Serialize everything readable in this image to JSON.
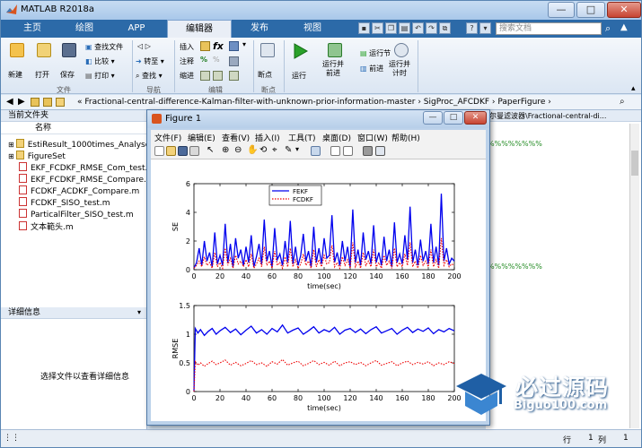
{
  "window": {
    "title": "MATLAB R2018a"
  },
  "tabs": [
    "主页",
    "绘图",
    "APP",
    "编辑器",
    "发布",
    "视图"
  ],
  "active_tab": "编辑器",
  "search": {
    "placeholder": "搜索文档"
  },
  "ribbon": {
    "file": {
      "new": "新建",
      "open": "打开",
      "save": "保存",
      "find_files": "查找文件",
      "compare": "比较",
      "print": "打印",
      "group": "文件"
    },
    "navigate": {
      "goto": "转至",
      "find": "查找",
      "group": "导航"
    },
    "edit": {
      "insert": "插入",
      "comment": "注释",
      "indent": "缩进",
      "fx": "fx",
      "group": "编辑"
    },
    "breakpoint": {
      "label": "断点",
      "group": "断点"
    },
    "run": {
      "run": "运行",
      "run_advance": "运行并\n前进",
      "run_section": "运行节",
      "advance": "前进",
      "run_time": "运行并\n计时"
    }
  },
  "address": {
    "path": "« Fractional-central-difference-Kalman-filter-with-unknown-prior-information-master › SigProc_AFCDKF › PaperFigure ›"
  },
  "file_panel": {
    "title": "当前文件夹",
    "column": "名称",
    "items": [
      {
        "name": "EstiResult_1000times_Analyse",
        "type": "folder"
      },
      {
        "name": "FigureSet",
        "type": "folder"
      },
      {
        "name": "EKF_FCDKF_RMSE_Com_test.m",
        "type": "m"
      },
      {
        "name": "EKF_FCDKF_RMSE_Compare.m",
        "type": "m"
      },
      {
        "name": "FCDKF_ACDKF_Compare.m",
        "type": "m"
      },
      {
        "name": "FCDKF_SISO_test.m",
        "type": "m"
      },
      {
        "name": "ParticalFilter_SISO_test.m",
        "type": "m"
      },
      {
        "name": "文本範头.m",
        "type": "m"
      }
    ]
  },
  "detail_panel": {
    "title": "详细信息",
    "message": "选择文件以查看详细信息"
  },
  "editor": {
    "path_fragment": "尔曼滤波器\\Fractional-central-di...",
    "comment1": "%%%%%%%%",
    "comment2": "%%%%%%%%"
  },
  "status": {
    "row_label": "行",
    "row": "1",
    "col_label": "列",
    "col": "1"
  },
  "figure": {
    "title": "Figure 1",
    "menu": [
      "文件(F)",
      "编辑(E)",
      "查看(V)",
      "插入(I)",
      "工具(T)",
      "桌面(D)",
      "窗口(W)",
      "帮助(H)"
    ]
  },
  "watermark": {
    "title": "必过源码",
    "url": "Biguo100.com"
  },
  "colors": {
    "fekf": "#0000ee",
    "fcdkf": "#ee0000",
    "accent": "#2c6aa8"
  },
  "chart_data": [
    {
      "type": "line",
      "xlabel": "time(sec)",
      "ylabel": "SE",
      "xlim": [
        0,
        200
      ],
      "ylim": [
        0,
        6
      ],
      "xticks": [
        0,
        20,
        40,
        60,
        80,
        100,
        120,
        140,
        160,
        180,
        200
      ],
      "yticks": [
        0,
        2,
        4,
        6
      ],
      "legend": "top-center",
      "series": [
        {
          "name": "FEKF",
          "style": "solid",
          "x": [
            0,
            2,
            4,
            6,
            8,
            10,
            12,
            14,
            16,
            18,
            20,
            22,
            24,
            26,
            28,
            30,
            32,
            34,
            36,
            38,
            40,
            42,
            44,
            46,
            48,
            50,
            52,
            54,
            56,
            58,
            60,
            62,
            64,
            66,
            68,
            70,
            72,
            74,
            76,
            78,
            80,
            82,
            84,
            86,
            88,
            90,
            92,
            94,
            96,
            98,
            100,
            102,
            104,
            106,
            108,
            110,
            112,
            114,
            116,
            118,
            120,
            122,
            124,
            126,
            128,
            130,
            132,
            134,
            136,
            138,
            140,
            142,
            144,
            146,
            148,
            150,
            152,
            154,
            156,
            158,
            160,
            162,
            164,
            166,
            168,
            170,
            172,
            174,
            176,
            178,
            180,
            182,
            184,
            186,
            188,
            190,
            192,
            194,
            196,
            198,
            200
          ],
          "values": [
            0.1,
            0.5,
            1.5,
            0.3,
            2.0,
            0.6,
            1.2,
            0.2,
            2.6,
            0.4,
            1.0,
            0.3,
            3.2,
            0.5,
            1.8,
            0.2,
            2.2,
            0.8,
            1.4,
            0.3,
            1.6,
            0.5,
            2.4,
            0.2,
            0.9,
            1.8,
            0.4,
            3.5,
            0.6,
            1.3,
            0.2,
            2.9,
            0.7,
            1.1,
            0.3,
            2.0,
            0.5,
            3.4,
            0.4,
            1.6,
            0.3,
            1.0,
            2.5,
            0.6,
            1.3,
            0.2,
            3.0,
            0.5,
            1.5,
            0.4,
            2.2,
            0.8,
            1.0,
            3.8,
            0.5,
            1.2,
            0.3,
            2.0,
            0.6,
            1.6,
            0.2,
            4.2,
            0.5,
            1.4,
            0.3,
            2.6,
            0.7,
            1.3,
            0.4,
            3.1,
            0.5,
            1.2,
            0.3,
            2.3,
            0.6,
            1.4,
            0.2,
            3.3,
            0.5,
            1.1,
            0.4,
            2.4,
            0.7,
            4.4,
            0.5,
            1.4,
            0.3,
            2.1,
            0.6,
            1.3,
            0.4,
            3.2,
            0.5,
            1.6,
            0.3,
            5.3,
            0.6,
            1.5,
            0.4,
            0.8,
            0.6
          ]
        },
        {
          "name": "FCDKF",
          "style": "dotted",
          "x": [
            0,
            2,
            4,
            6,
            8,
            10,
            12,
            14,
            16,
            18,
            20,
            22,
            24,
            26,
            28,
            30,
            32,
            34,
            36,
            38,
            40,
            42,
            44,
            46,
            48,
            50,
            52,
            54,
            56,
            58,
            60,
            62,
            64,
            66,
            68,
            70,
            72,
            74,
            76,
            78,
            80,
            82,
            84,
            86,
            88,
            90,
            92,
            94,
            96,
            98,
            100,
            102,
            104,
            106,
            108,
            110,
            112,
            114,
            116,
            118,
            120,
            122,
            124,
            126,
            128,
            130,
            132,
            134,
            136,
            138,
            140,
            142,
            144,
            146,
            148,
            150,
            152,
            154,
            156,
            158,
            160,
            162,
            164,
            166,
            168,
            170,
            172,
            174,
            176,
            178,
            180,
            182,
            184,
            186,
            188,
            190,
            192,
            194,
            196,
            198,
            200
          ],
          "values": [
            0.1,
            0.3,
            0.6,
            0.2,
            0.9,
            0.3,
            0.5,
            0.1,
            1.2,
            0.2,
            0.5,
            0.1,
            1.5,
            0.3,
            0.8,
            0.1,
            1.0,
            0.4,
            0.6,
            0.2,
            0.7,
            0.2,
            1.1,
            0.1,
            0.4,
            0.8,
            0.2,
            1.6,
            0.3,
            0.6,
            0.1,
            1.3,
            0.3,
            0.5,
            0.1,
            0.9,
            0.2,
            1.5,
            0.2,
            0.7,
            0.1,
            0.4,
            1.1,
            0.3,
            0.6,
            0.1,
            1.4,
            0.2,
            0.7,
            0.2,
            1.0,
            0.4,
            0.5,
            1.7,
            0.2,
            0.5,
            0.1,
            0.9,
            0.3,
            0.7,
            0.1,
            1.9,
            0.2,
            0.6,
            0.1,
            1.2,
            0.3,
            0.6,
            0.2,
            1.4,
            0.2,
            0.5,
            0.1,
            1.0,
            0.3,
            0.6,
            0.1,
            1.5,
            0.2,
            0.5,
            0.2,
            1.1,
            0.3,
            1.9,
            0.2,
            0.6,
            0.1,
            1.0,
            0.3,
            0.6,
            0.2,
            1.4,
            0.2,
            0.7,
            0.1,
            2.2,
            0.3,
            0.7,
            0.2,
            0.4,
            0.3
          ]
        }
      ]
    },
    {
      "type": "line",
      "xlabel": "time(sec)",
      "ylabel": "RMSE",
      "xlim": [
        0,
        200
      ],
      "ylim": [
        0,
        1.5
      ],
      "xticks": [
        0,
        20,
        40,
        60,
        80,
        100,
        120,
        140,
        160,
        180,
        200
      ],
      "yticks": [
        0,
        0.5,
        1,
        1.5
      ],
      "series": [
        {
          "name": "FEKF",
          "style": "solid",
          "x": [
            0,
            1,
            3,
            5,
            8,
            11,
            14,
            17,
            20,
            24,
            28,
            32,
            36,
            40,
            44,
            48,
            52,
            56,
            60,
            64,
            68,
            72,
            76,
            80,
            84,
            88,
            92,
            96,
            100,
            104,
            108,
            112,
            116,
            120,
            124,
            128,
            132,
            136,
            140,
            144,
            148,
            152,
            156,
            160,
            164,
            168,
            172,
            176,
            180,
            184,
            188,
            192,
            196,
            200
          ],
          "values": [
            0,
            1.1,
            1.02,
            1.08,
            0.98,
            1.05,
            1.1,
            1.0,
            1.06,
            1.12,
            1.03,
            1.09,
            0.99,
            1.07,
            1.14,
            1.02,
            1.08,
            1.0,
            1.1,
            1.04,
            1.16,
            1.02,
            1.07,
            1.11,
            1.0,
            1.06,
            1.13,
            1.02,
            1.08,
            1.04,
            1.12,
            1.0,
            1.07,
            1.1,
            1.03,
            1.09,
            1.01,
            1.08,
            1.13,
            1.02,
            1.06,
            1.1,
            1.0,
            1.07,
            1.12,
            1.03,
            1.09,
            1.05,
            1.11,
            1.01,
            1.08,
            1.04,
            1.1,
            1.06
          ]
        },
        {
          "name": "FCDKF",
          "style": "dotted",
          "x": [
            0,
            1,
            3,
            5,
            8,
            11,
            14,
            17,
            20,
            24,
            28,
            32,
            36,
            40,
            44,
            48,
            52,
            56,
            60,
            64,
            68,
            72,
            76,
            80,
            84,
            88,
            92,
            96,
            100,
            104,
            108,
            112,
            116,
            120,
            124,
            128,
            132,
            136,
            140,
            144,
            148,
            152,
            156,
            160,
            164,
            168,
            172,
            176,
            180,
            184,
            188,
            192,
            196,
            200
          ],
          "values": [
            0,
            0.52,
            0.46,
            0.5,
            0.44,
            0.49,
            0.53,
            0.47,
            0.5,
            0.55,
            0.46,
            0.51,
            0.45,
            0.49,
            0.54,
            0.47,
            0.5,
            0.44,
            0.52,
            0.48,
            0.56,
            0.46,
            0.5,
            0.53,
            0.45,
            0.49,
            0.54,
            0.47,
            0.51,
            0.46,
            0.53,
            0.45,
            0.5,
            0.52,
            0.47,
            0.51,
            0.45,
            0.5,
            0.54,
            0.46,
            0.49,
            0.52,
            0.45,
            0.5,
            0.53,
            0.47,
            0.51,
            0.48,
            0.52,
            0.45,
            0.5,
            0.47,
            0.52,
            0.49
          ]
        }
      ]
    }
  ]
}
